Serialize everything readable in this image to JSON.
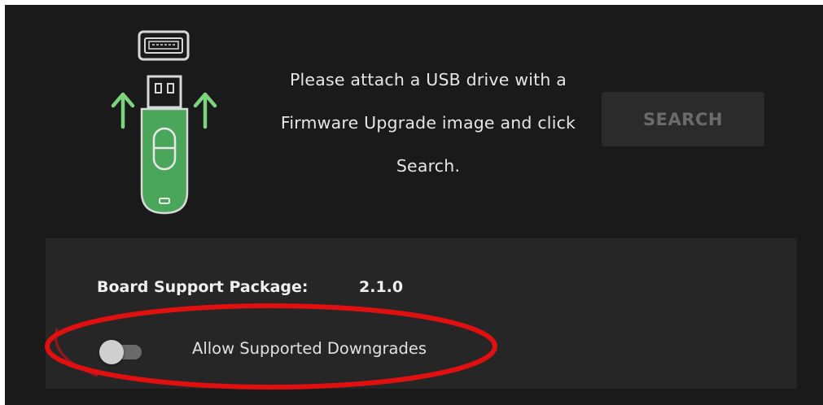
{
  "usb_graphic": {
    "icon": "usb-drive-insert-icon",
    "arrow_color": "#7ed37e",
    "drive_color": "#4aa65a"
  },
  "instructions": {
    "line1": "Please attach a USB drive with a",
    "line2": "Firmware Upgrade image and click",
    "line3": "Search."
  },
  "search_button": {
    "label": "SEARCH"
  },
  "board_support": {
    "label": "Board Support Package:",
    "value": "2.1.0"
  },
  "downgrade_toggle": {
    "label": "Allow Supported Downgrades",
    "enabled": false
  },
  "annotation": {
    "highlight_color": "#e01010"
  }
}
